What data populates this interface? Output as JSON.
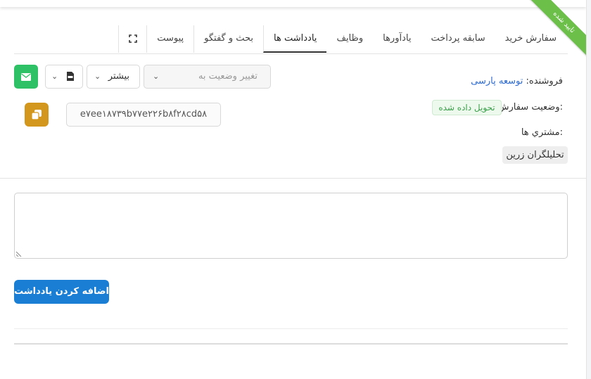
{
  "ribbon": {
    "label": "تایید شده",
    "color": "#6cc04a"
  },
  "tabs": [
    {
      "label": "سفارش خرید"
    },
    {
      "label": "سابقه پرداخت"
    },
    {
      "label": "یادآورها"
    },
    {
      "label": "وظایف"
    },
    {
      "label": "یادداشت ها",
      "active": true
    },
    {
      "label": "بحث و گفتگو"
    },
    {
      "label": "پیوست"
    }
  ],
  "toolbar": {
    "status_placeholder": "تغییر وضعیت به",
    "more_label": "بیشتر",
    "pdf_icon": "pdf-file-icon",
    "mail_icon": "envelope-icon",
    "mail_color": "#2ec166"
  },
  "order": {
    "vendor_label": "فروشنده:",
    "vendor_value": "توسعه پارسی",
    "status_label": "وضعیت سفارش:",
    "status_value": "تحویل داده شده",
    "customers_label": "مشتري ها:",
    "customer_value": "تحلیلگران زرین",
    "hash": "e۷ee۱۸۷۳۹b۷۷e۲۲۶b۸f۲۸cd۵۸",
    "copy_color": "#d4971d"
  },
  "notes": {
    "textarea_value": "",
    "add_button": "اضافه کردن یادداشت",
    "add_button_color": "#1a7fd4"
  }
}
